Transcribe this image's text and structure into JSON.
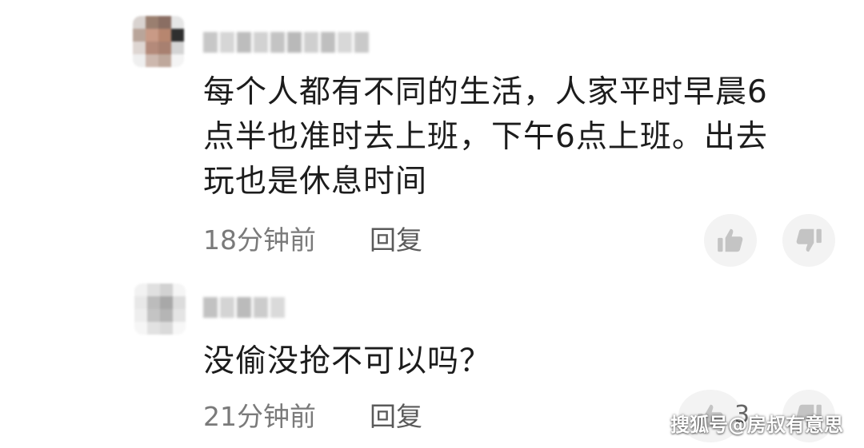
{
  "comments": [
    {
      "text": "每个人都有不同的生活，人家平时早晨6\n点半也准时去上班，下午6点上班。出去\n玩也是休息时间",
      "time": "18分钟前",
      "reply_label": "回复",
      "like_count": ""
    },
    {
      "text": "没偷没抢不可以吗？",
      "time": "21分钟前",
      "reply_label": "回复",
      "like_count": "3"
    }
  ],
  "icons": {
    "like": "thumbs-up-icon",
    "dislike": "thumbs-down-icon"
  },
  "colors": {
    "background": "#ffffff",
    "text": "#1c1c1c",
    "meta": "#7a7a7a",
    "button_bg": "#f3f3f3",
    "icon": "#c4c4c4"
  },
  "watermark": "搜狐号@房叔有意思"
}
